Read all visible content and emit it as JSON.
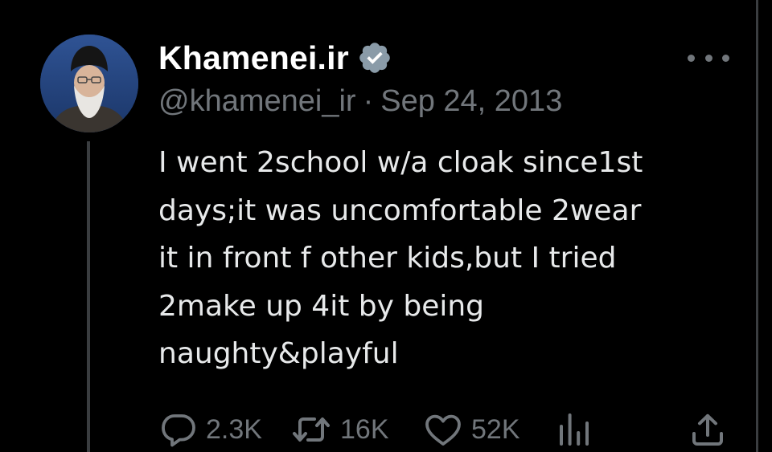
{
  "tweet": {
    "display_name": "Khamenei.ir",
    "handle": "@khamenei_ir",
    "separator": "·",
    "date": "Sep 24, 2013",
    "text_lines": [
      "I went 2school w/a cloak since1st",
      "days;it was uncomfortable 2wear",
      "it in front f other kids,but I tried",
      "2make up 4it by being",
      "naughty&playful"
    ]
  },
  "actions": {
    "reply_count": "2.3K",
    "retweet_count": "16K",
    "like_count": "52K"
  },
  "icons": {
    "verified": "verified-badge-icon",
    "more": "more-options-icon",
    "reply": "reply-icon",
    "retweet": "retweet-icon",
    "like": "heart-icon",
    "views": "views-icon",
    "share": "share-icon"
  },
  "colors": {
    "background": "#000000",
    "primary_text": "#e7e9ea",
    "secondary_text": "#71767b",
    "border": "#3a3d40",
    "verified_badge": "#8a9ba8"
  }
}
